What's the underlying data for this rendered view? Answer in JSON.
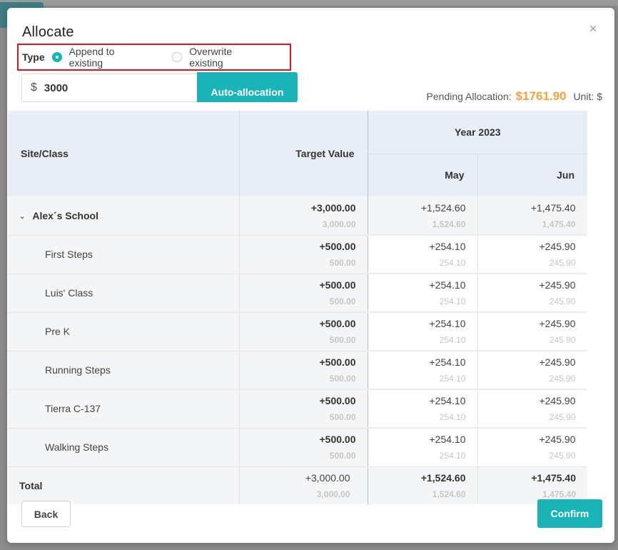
{
  "modal": {
    "title": "Allocate",
    "close_glyph": "×"
  },
  "type": {
    "label": "Type",
    "options": [
      {
        "label": "Append to existing",
        "checked": true
      },
      {
        "label": "Overwrite existing",
        "checked": false
      }
    ]
  },
  "amount": {
    "currency": "$",
    "value": "3000"
  },
  "auto_allocation_label": "Auto-allocation",
  "pending": {
    "label": "Pending Allocation:",
    "amount": "$1761.90",
    "unit": "Unit: $"
  },
  "table": {
    "headers": {
      "site": "Site/Class",
      "target": "Target Value",
      "year": "Year 2023",
      "months": [
        "May",
        "Jun"
      ]
    },
    "parent": {
      "name": "Alex´s School",
      "target": "+3,000.00",
      "target_sub": "3,000.00",
      "may": "+1,524.60",
      "may_sub": "1,524.60",
      "jun": "+1,475.40",
      "jun_sub": "1,475.40"
    },
    "rows": [
      {
        "name": "First Steps",
        "target": "+500.00",
        "target_sub": "500.00",
        "may": "+254.10",
        "may_sub": "254.10",
        "jun": "+245.90",
        "jun_sub": "245.90"
      },
      {
        "name": "Luis' Class",
        "target": "+500.00",
        "target_sub": "500.00",
        "may": "+254.10",
        "may_sub": "254.10",
        "jun": "+245.90",
        "jun_sub": "245.90"
      },
      {
        "name": "Pre K",
        "target": "+500.00",
        "target_sub": "500.00",
        "may": "+254.10",
        "may_sub": "254.10",
        "jun": "+245.90",
        "jun_sub": "245.90"
      },
      {
        "name": "Running Steps",
        "target": "+500.00",
        "target_sub": "500.00",
        "may": "+254.10",
        "may_sub": "254.10",
        "jun": "+245.90",
        "jun_sub": "245.90"
      },
      {
        "name": "Tierra C-137",
        "target": "+500.00",
        "target_sub": "500.00",
        "may": "+254.10",
        "may_sub": "254.10",
        "jun": "+245.90",
        "jun_sub": "245.90"
      },
      {
        "name": "Walking Steps",
        "target": "+500.00",
        "target_sub": "500.00",
        "may": "+254.10",
        "may_sub": "254.10",
        "jun": "+245.90",
        "jun_sub": "245.90"
      }
    ],
    "total": {
      "name": "Total",
      "target": "+3,000.00",
      "target_sub": "3,000.00",
      "may": "+1,524.60",
      "may_sub": "1,524.60",
      "jun": "+1,475.40",
      "jun_sub": "1,475.40"
    }
  },
  "footer": {
    "back_label": "Back",
    "confirm_label": "Confirm"
  },
  "colors": {
    "accent": "#1ab3b7",
    "pending_amount": "#f5a23d",
    "highlight_border": "#e0141e",
    "header_bg": "#e9edf5"
  }
}
